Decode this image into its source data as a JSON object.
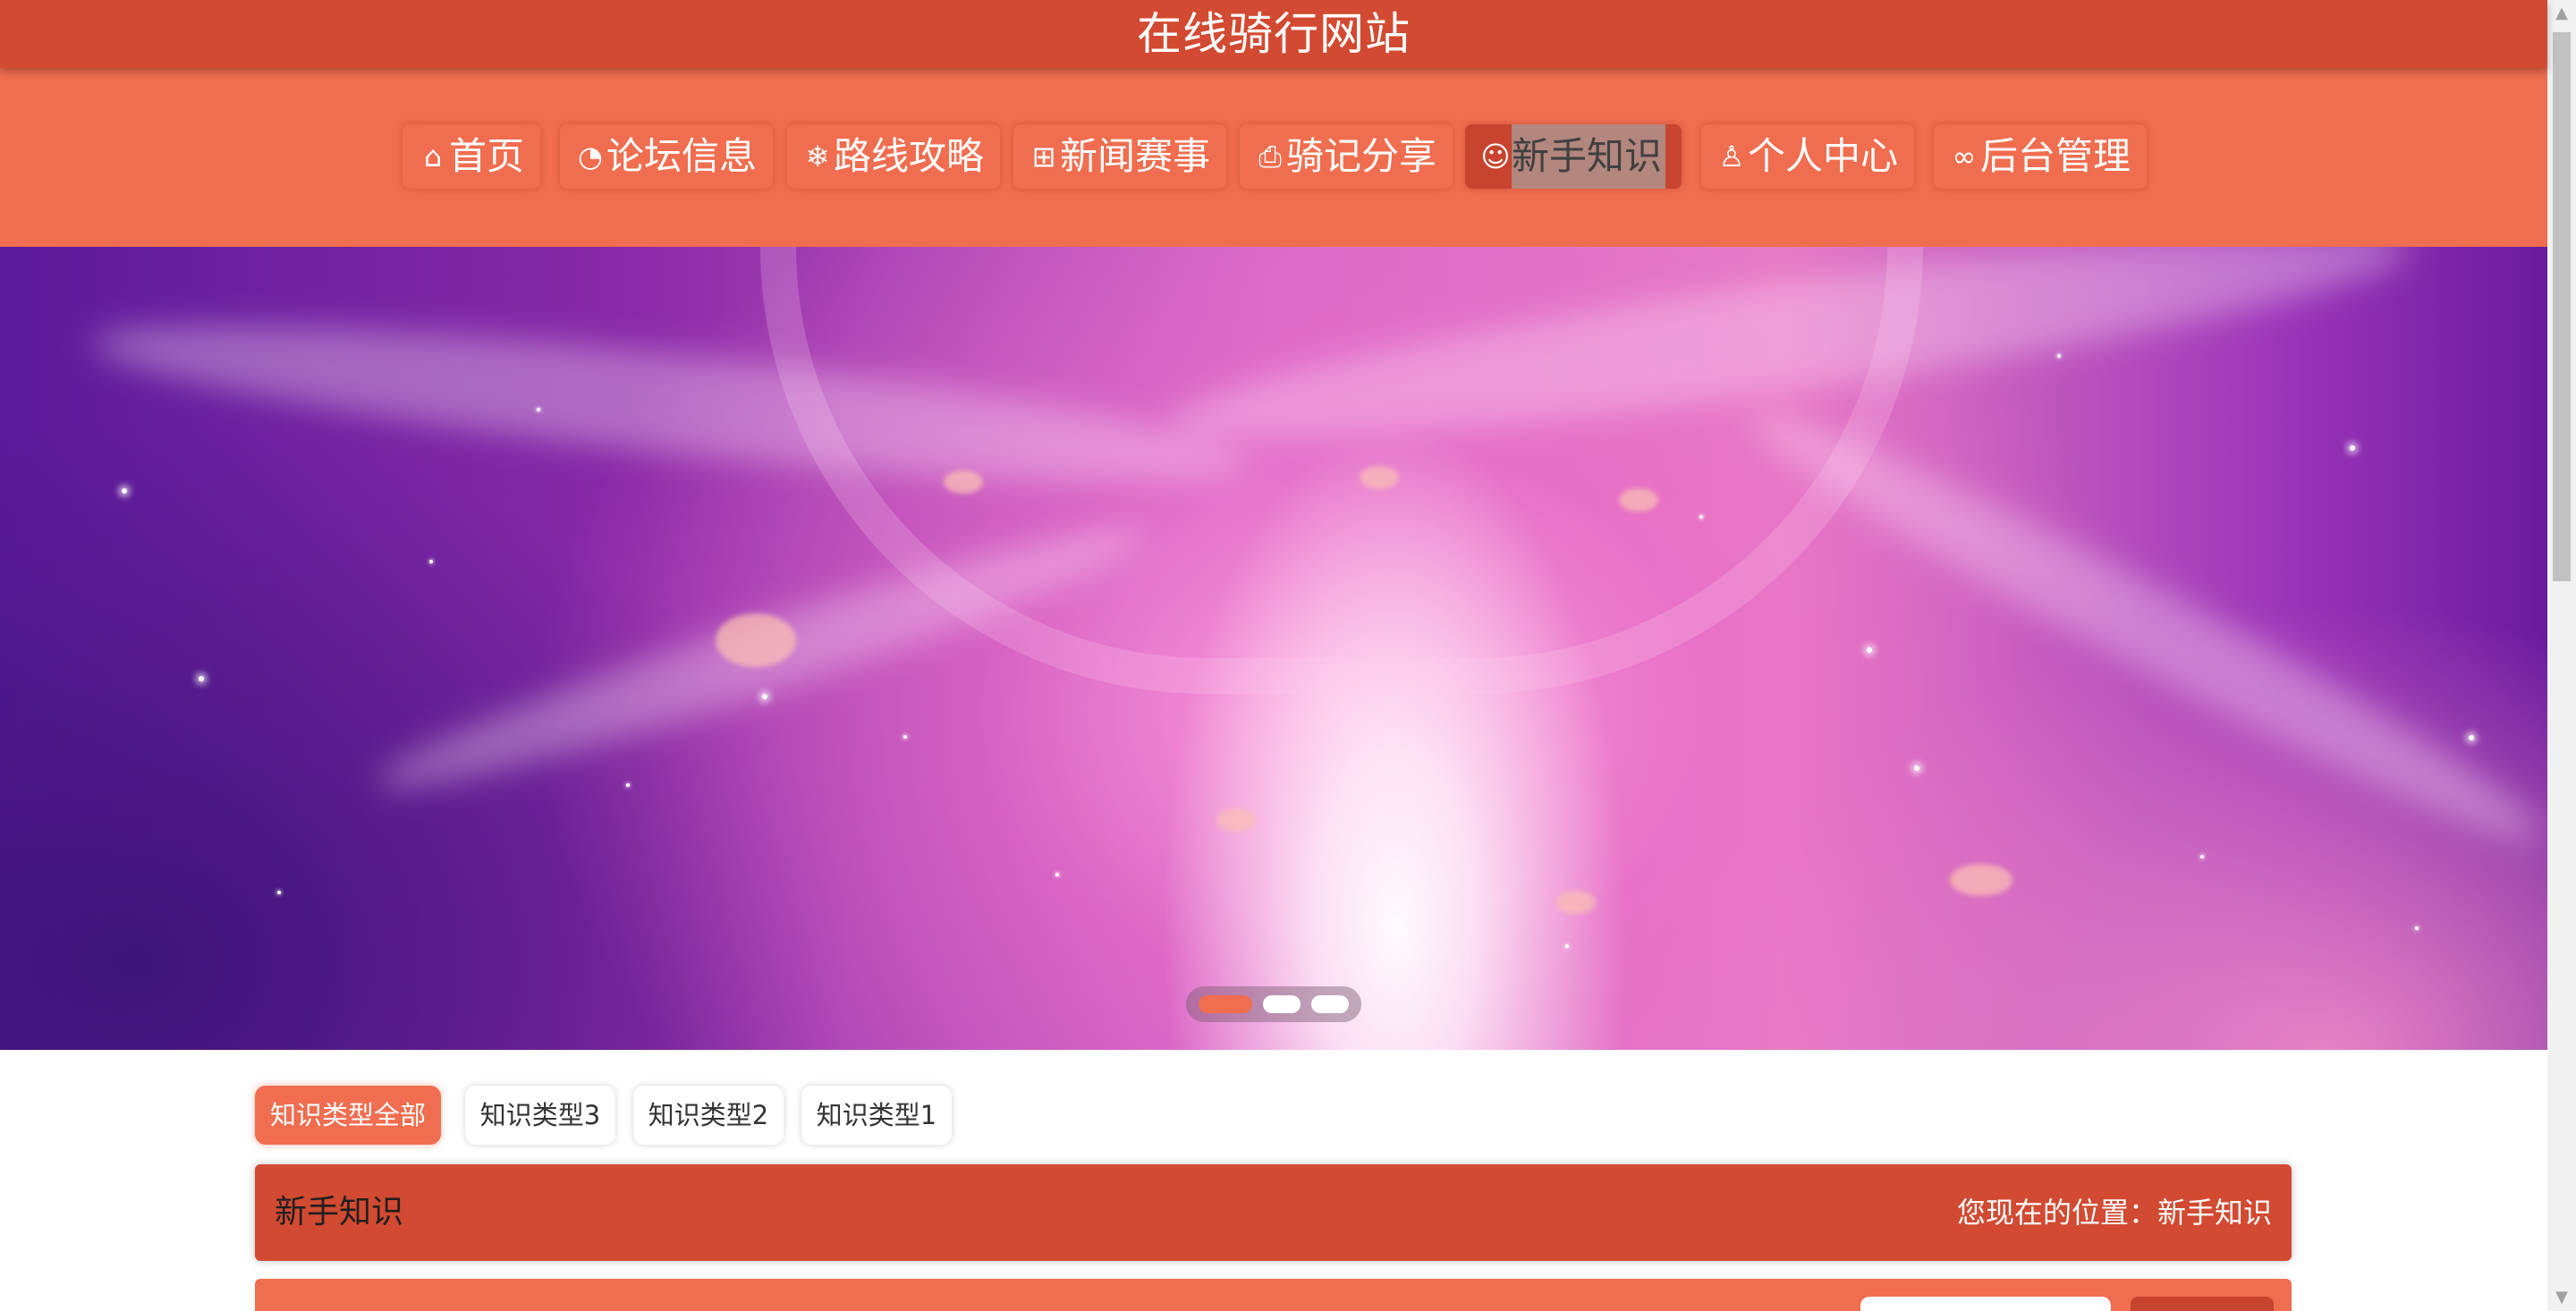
{
  "site": {
    "title": "在线骑行网站"
  },
  "nav": {
    "items": [
      {
        "icon": "home-icon",
        "glyph": "⌂",
        "label": "首页",
        "active": false
      },
      {
        "icon": "chat-bubble-icon",
        "glyph": "◔",
        "label": "论坛信息",
        "active": false
      },
      {
        "icon": "snowflake-icon",
        "glyph": "❄",
        "label": "路线攻略",
        "active": false
      },
      {
        "icon": "news-grid-icon",
        "glyph": "⊞",
        "label": "新闻赛事",
        "active": false
      },
      {
        "icon": "printer-icon",
        "glyph": "⎙",
        "label": "骑记分享",
        "active": false
      },
      {
        "icon": "smile-icon",
        "glyph": "☺",
        "label": "新手知识",
        "active": true
      },
      {
        "icon": "user-icon",
        "glyph": "♙",
        "label": "个人中心",
        "active": false
      },
      {
        "icon": "link-icon",
        "glyph": "∞",
        "label": "后台管理",
        "active": false
      }
    ]
  },
  "carousel": {
    "slide_count": 3,
    "active_index": 0
  },
  "categories": {
    "tabs": [
      {
        "label": "知识类型全部",
        "active": true
      },
      {
        "label": "知识类型3",
        "active": false
      },
      {
        "label": "知识类型2",
        "active": false
      },
      {
        "label": "知识类型1",
        "active": false
      }
    ]
  },
  "section": {
    "title": "新手知识",
    "breadcrumb": "您现在的位置：新手知识"
  },
  "colors": {
    "title_bar": "#d24a31",
    "nav_bar": "#f06d4f",
    "active_nav": "#c9442e",
    "accent": "#f06d4f"
  }
}
